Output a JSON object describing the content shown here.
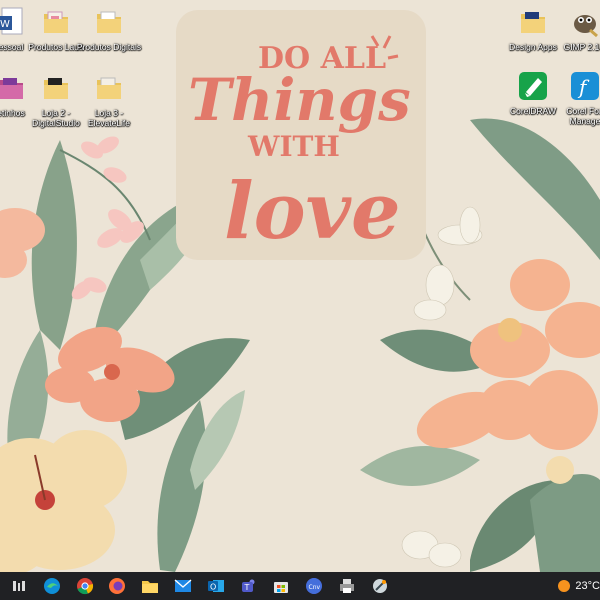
{
  "desktop": {
    "icons_left": [
      {
        "label": "essoal"
      },
      {
        "label": "Produtos Laua"
      },
      {
        "label": "Produtos Digitais"
      },
      {
        "label": "etinhos"
      },
      {
        "label": "Loja 2 - DigitalStudio"
      },
      {
        "label": "Loja 3 - ElevateLife"
      }
    ],
    "icons_right": [
      {
        "label": "Design Apps"
      },
      {
        "label": "GIMP 2.10."
      },
      {
        "label": "CorelDRAW"
      },
      {
        "label": "Corel Fon Manage"
      }
    ]
  },
  "wallpaper": {
    "quote_line1": "DO ALL",
    "quote_line2": "Things",
    "quote_line3": "WITH",
    "quote_line4": "love",
    "quote_color": "#e2796a"
  },
  "taskbar": {
    "apps": [
      {
        "icon": "task-view-icon"
      },
      {
        "icon": "edge-icon"
      },
      {
        "icon": "chrome-icon"
      },
      {
        "icon": "firefox-icon"
      },
      {
        "icon": "file-explorer-icon"
      },
      {
        "icon": "mail-icon"
      },
      {
        "icon": "outlook-icon"
      },
      {
        "icon": "teams-icon"
      },
      {
        "icon": "store-icon"
      },
      {
        "icon": "canva-icon"
      },
      {
        "icon": "printer-icon"
      },
      {
        "icon": "design-tool-icon"
      }
    ],
    "weather": {
      "temperature": "23°C"
    }
  }
}
